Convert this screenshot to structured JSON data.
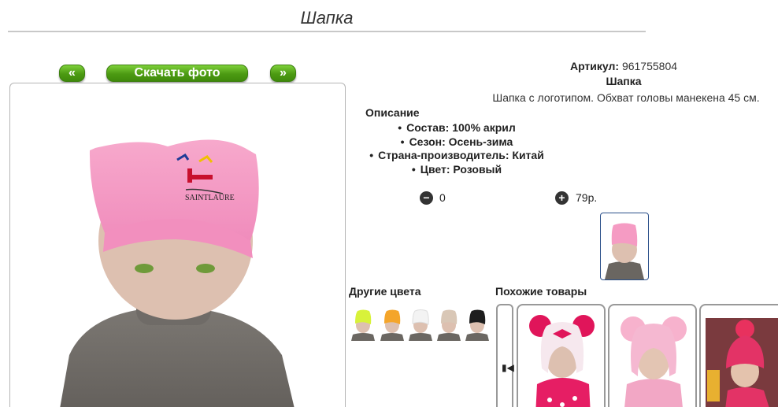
{
  "page": {
    "title": "Шапка"
  },
  "nav": {
    "prev_label": "«",
    "download_label": "Скачать фото",
    "next_label": "»"
  },
  "product": {
    "article_label": "Артикул:",
    "article_value": "961755804",
    "name": "Шапка",
    "short_description": "Шапка с логотипом. Обхват головы манекена 45 см.",
    "description_heading": "Описание",
    "attributes": [
      "Состав: 100% акрил",
      "Сезон: Осень-зима",
      "Страна-производитель: Китай",
      "Цвет: Розовый"
    ],
    "brand_logo_text": "SAINTLAURE"
  },
  "cart": {
    "minus_icon": "minus-circle-icon",
    "plus_icon": "plus-circle-icon",
    "quantity": "0",
    "price": "79р."
  },
  "other_colors": {
    "heading": "Другие цвета",
    "swatches": [
      {
        "color": "#d8f23a",
        "name": "yellow-green"
      },
      {
        "color": "#f4a52a",
        "name": "orange"
      },
      {
        "color": "#f3f3f3",
        "name": "white"
      },
      {
        "color": "#d9c7b6",
        "name": "beige"
      },
      {
        "color": "#1d1d1d",
        "name": "black"
      }
    ]
  },
  "similar": {
    "heading": "Похожие товары",
    "scroll_icon": "skip-back-icon"
  },
  "colors": {
    "accent_green": "#4c9a12",
    "hat_pink": "#f59bc3",
    "frame_blue": "#2a4f8a"
  }
}
